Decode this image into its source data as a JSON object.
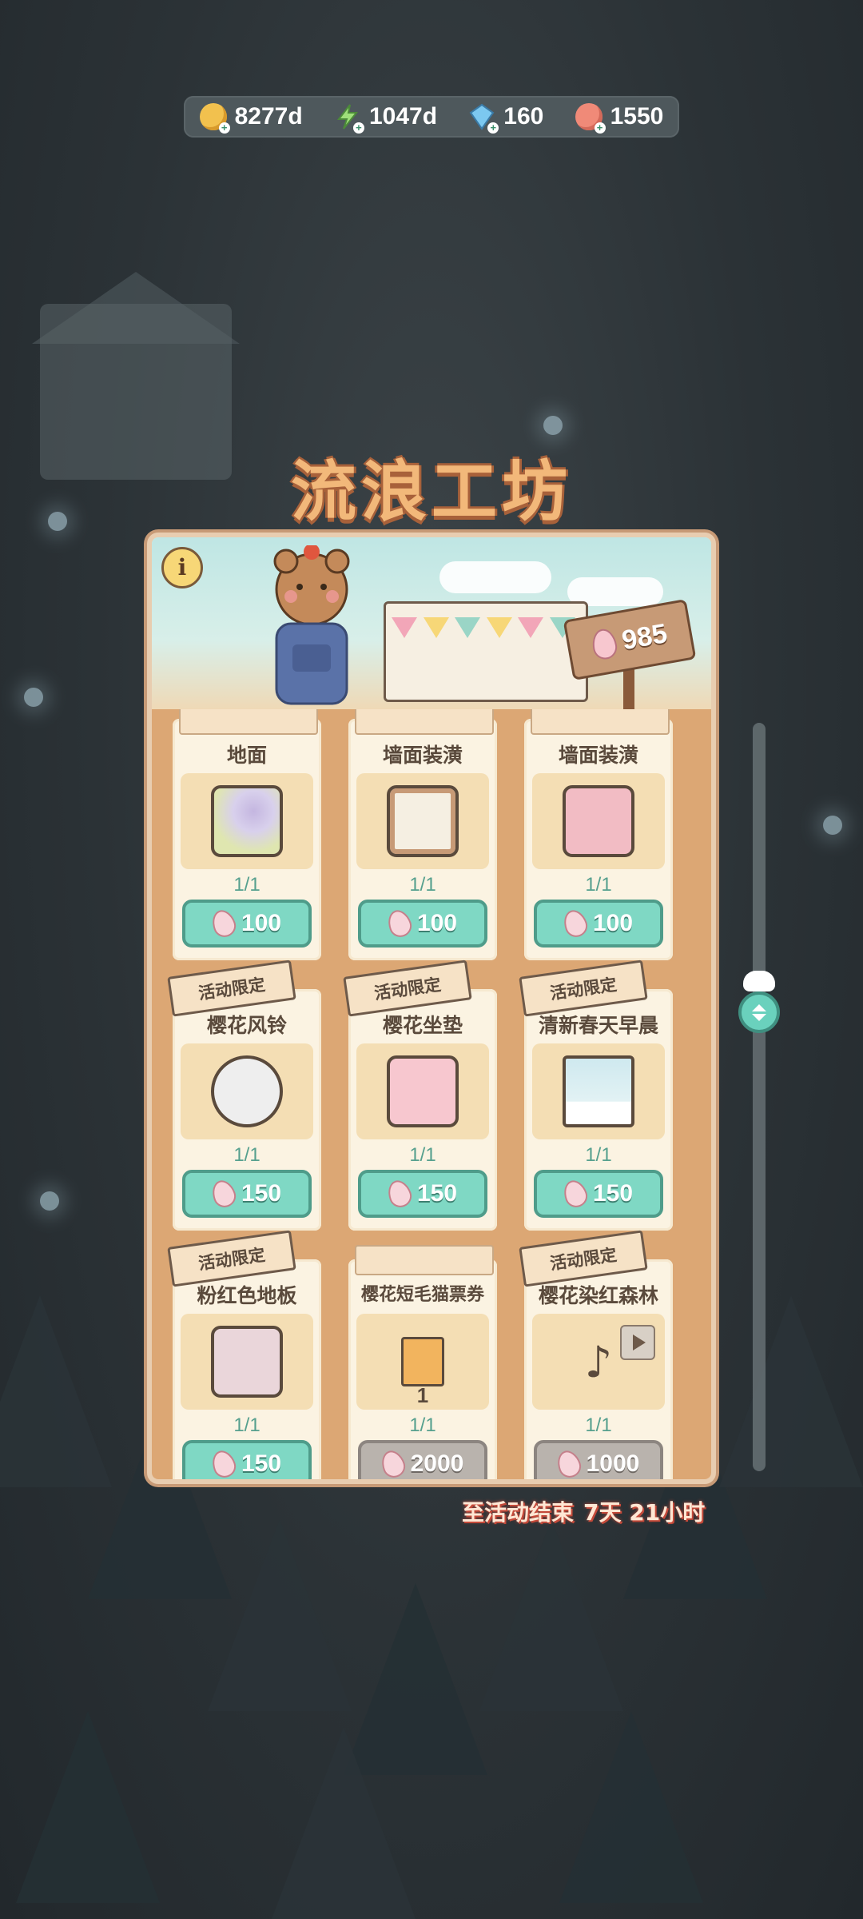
{
  "currencies": [
    {
      "name": "coin",
      "icon": "coin-icon",
      "value": "8277d"
    },
    {
      "name": "energy",
      "icon": "lightning-icon",
      "value": "1047d"
    },
    {
      "name": "gem",
      "icon": "gem-icon",
      "value": "160"
    },
    {
      "name": "cat-token",
      "icon": "cat-token-icon",
      "value": "1550"
    }
  ],
  "title": "流浪工坊",
  "banner": {
    "info_label": "i",
    "petal_balance": "985"
  },
  "items": [
    {
      "tag": "",
      "name": "地面",
      "limit": "1/1",
      "price": "100",
      "image": "ground"
    },
    {
      "tag": "",
      "name": "墙面装潢",
      "limit": "1/1",
      "price": "100",
      "image": "frame"
    },
    {
      "tag": "",
      "name": "墙面装潢",
      "limit": "1/1",
      "price": "100",
      "image": "bag"
    },
    {
      "tag": "活动限定",
      "name": "樱花风铃",
      "limit": "1/1",
      "price": "150",
      "image": "chime"
    },
    {
      "tag": "活动限定",
      "name": "樱花坐垫",
      "limit": "1/1",
      "price": "150",
      "image": "petal"
    },
    {
      "tag": "活动限定",
      "name": "清新春天早晨",
      "limit": "1/1",
      "price": "150",
      "image": "window"
    },
    {
      "tag": "活动限定",
      "name": "粉红色地板",
      "limit": "1/1",
      "price": "150",
      "image": "floor"
    },
    {
      "tag": "",
      "name": "樱花短毛猫票券",
      "limit": "1/1",
      "price": "2000",
      "image": "ticket",
      "ticket_count": "1"
    },
    {
      "tag": "活动限定",
      "name": "樱花染红森林",
      "limit": "1/1",
      "price": "1000",
      "image": "music"
    }
  ],
  "timer": {
    "label": "至活动结束",
    "value": "7天 21小时"
  },
  "colors": {
    "accent_button": "#7fd8c4",
    "disabled_button": "#b9b3ad",
    "title": "#f2b87a",
    "panel_bg": "#dca774"
  }
}
